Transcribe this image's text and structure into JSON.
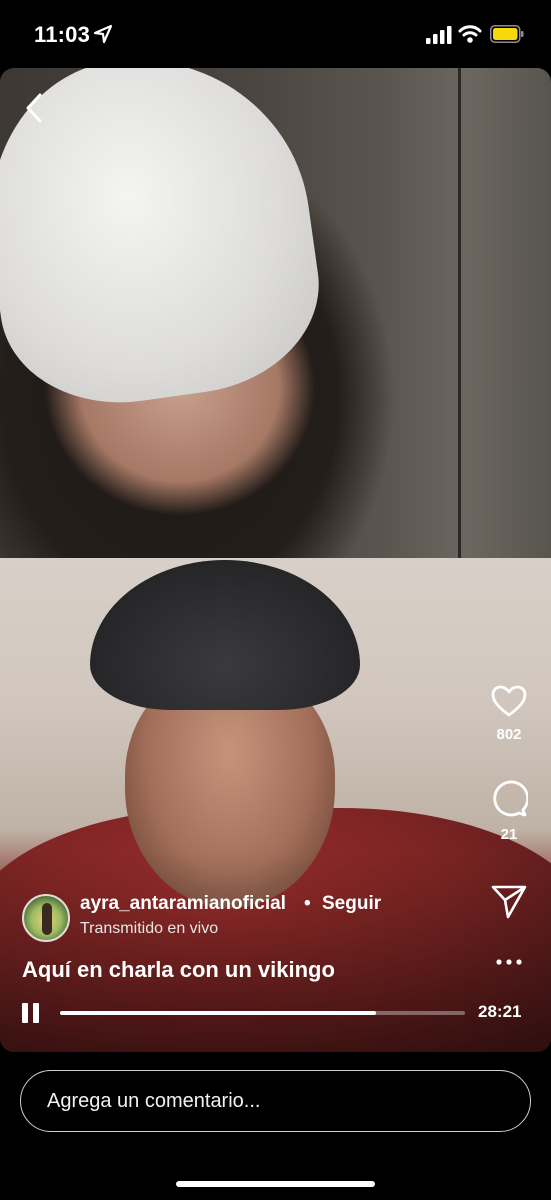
{
  "status_bar": {
    "time": "11:03",
    "icons": [
      "location-arrow-icon",
      "cellular-signal-icon",
      "wifi-icon",
      "battery-icon"
    ],
    "battery_color": "#f5d90a"
  },
  "live": {
    "username": "ayra_antaramianoficial",
    "separator": "•",
    "follow_label": "Seguir",
    "status": "Transmitido en vivo",
    "title": "Aquí en charla con un vikingo"
  },
  "actions": {
    "like_count": "802",
    "comment_count": "21"
  },
  "playback": {
    "duration": "28:21",
    "progress": 0.78
  },
  "comment_box": {
    "placeholder": "Agrega un comentario..."
  }
}
